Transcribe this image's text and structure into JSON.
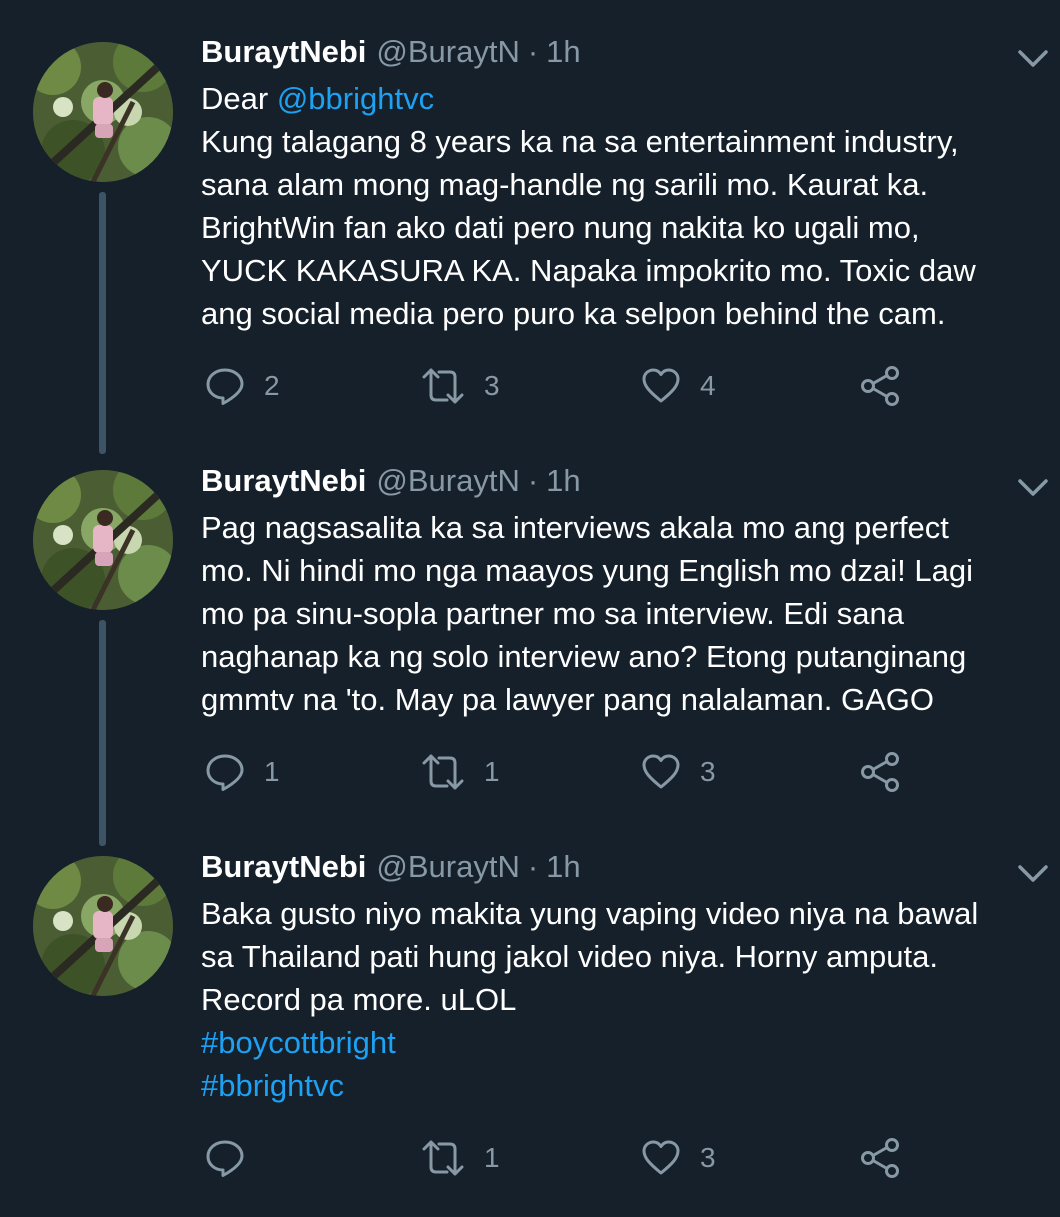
{
  "colors": {
    "background": "#15202b",
    "text": "#ffffff",
    "secondary": "#8899a6",
    "link": "#1da1f2",
    "thread_line": "#3d5466"
  },
  "tweets": [
    {
      "name": "BuraytNebi",
      "handle": "@BuraytN",
      "separator": "·",
      "time": "1h",
      "greeting": "Dear ",
      "mention": "@bbrightvc",
      "lines": [
        "Kung talagang 8 years ka na sa entertainment industry,",
        "sana alam mong mag-handle ng sarili mo. Kaurat ka.",
        "BrightWin fan ako dati pero nung nakita ko ugali mo,",
        "YUCK KAKASURA KA. Napaka impokrito mo. Toxic daw",
        "ang social media pero puro ka selpon behind the cam."
      ],
      "replies": "2",
      "retweets": "3",
      "likes": "4"
    },
    {
      "name": "BuraytNebi",
      "handle": "@BuraytN",
      "separator": "·",
      "time": "1h",
      "lines": [
        "Pag nagsasalita ka sa interviews akala mo ang perfect",
        "mo. Ni hindi mo nga maayos yung English mo dzai! Lagi",
        "mo pa sinu-sopla partner mo sa interview. Edi sana",
        "naghanap ka ng solo interview ano? Etong putanginang",
        "gmmtv na 'to. May pa lawyer pang nalalaman. GAGO"
      ],
      "replies": "1",
      "retweets": "1",
      "likes": "3"
    },
    {
      "name": "BuraytNebi",
      "handle": "@BuraytN",
      "separator": "·",
      "time": "1h",
      "lines": [
        "Baka gusto niyo makita yung vaping video niya na bawal",
        "sa Thailand pati hung jakol video niya. Horny amputa.",
        "Record pa more. uLOL"
      ],
      "hashtags": [
        "#boycottbright",
        "#bbrightvc"
      ],
      "retweets": "1",
      "likes": "3"
    }
  ]
}
